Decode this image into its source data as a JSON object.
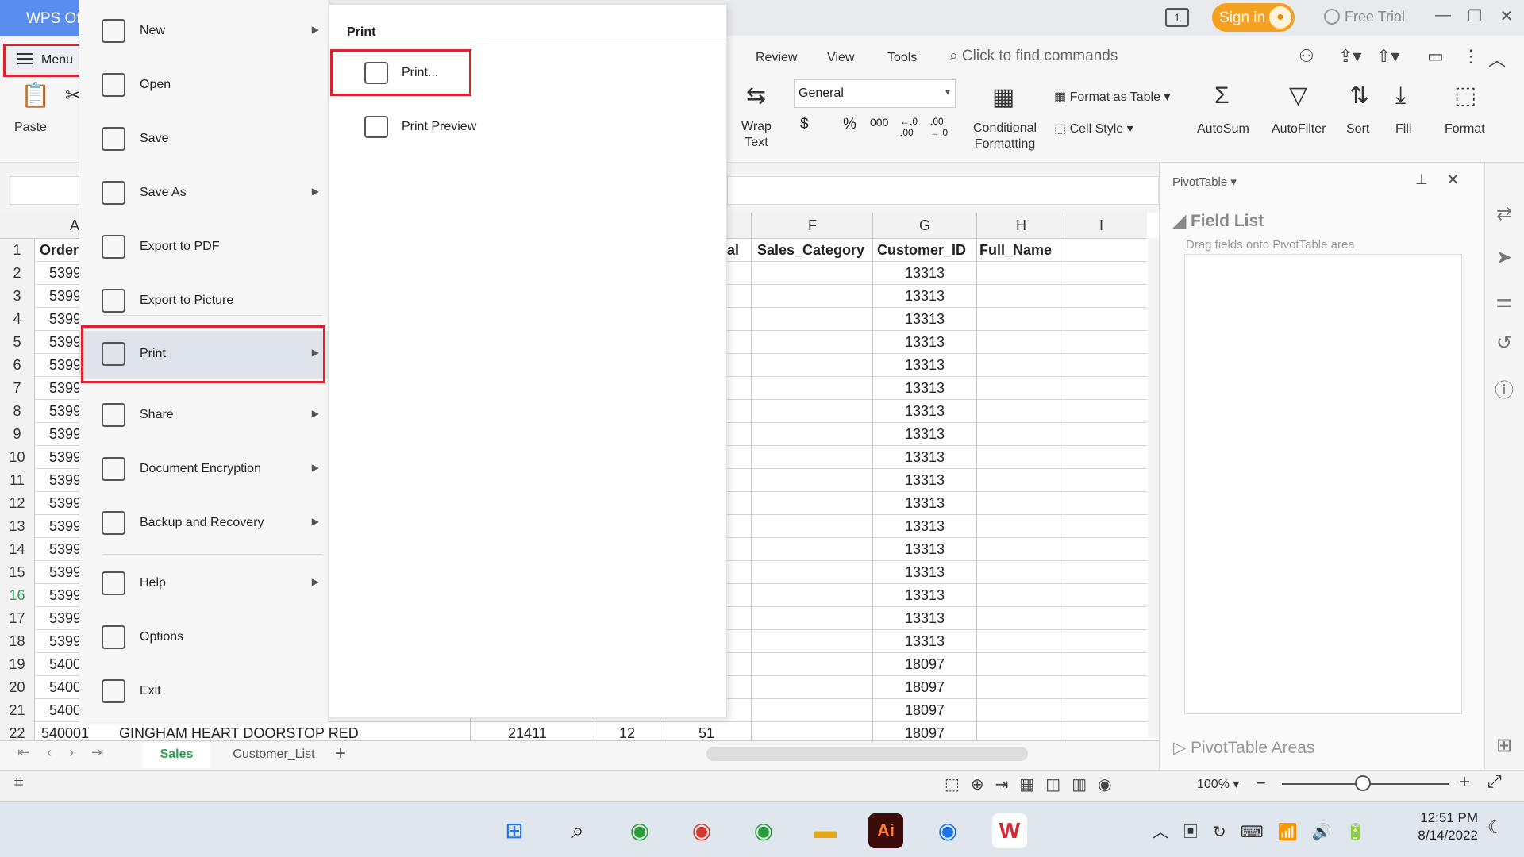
{
  "titlebar": {
    "app_tab": "WPS Office",
    "tab_count": "1",
    "signin": "Sign in",
    "free_trial": "Free Trial"
  },
  "ribbon": {
    "menu_label": "Menu",
    "tabs": [
      "Review",
      "View",
      "Tools"
    ],
    "search_placeholder": "Click to find commands",
    "paste_label": "Paste",
    "wrap_text": [
      "Wrap",
      "Text"
    ],
    "number_format": "General",
    "conditional_formatting": [
      "Conditional",
      "Formatting"
    ],
    "format_as_table": "Format as Table",
    "cell_style": "Cell Style",
    "autosum": "AutoSum",
    "autofilter": "AutoFilter",
    "sort": "Sort",
    "fill": "Fill",
    "format": "Format",
    "number_symbols": [
      "$",
      "%",
      "000",
      "←.0 .00",
      ".00 →.0"
    ]
  },
  "file_menu": {
    "items": [
      {
        "label": "New",
        "icon": "new-file-icon",
        "submenu": true
      },
      {
        "label": "Open",
        "icon": "folder-icon",
        "submenu": false
      },
      {
        "label": "Save",
        "icon": "save-icon",
        "submenu": false
      },
      {
        "label": "Save As",
        "icon": "save-as-icon",
        "submenu": true
      },
      {
        "label": "Export to PDF",
        "icon": "pdf-icon",
        "submenu": false
      },
      {
        "label": "Export to Picture",
        "icon": "picture-icon",
        "submenu": false
      },
      {
        "label": "Print",
        "icon": "printer-icon",
        "submenu": true
      },
      {
        "label": "Share",
        "icon": "share-icon",
        "submenu": true
      },
      {
        "label": "Document Encryption",
        "icon": "encryption-icon",
        "submenu": true
      },
      {
        "label": "Backup and Recovery",
        "icon": "backup-icon",
        "submenu": true
      },
      {
        "label": "Help",
        "icon": "help-icon",
        "submenu": true
      },
      {
        "label": "Options",
        "icon": "gear-icon",
        "submenu": false
      },
      {
        "label": "Exit",
        "icon": "exit-icon",
        "submenu": false
      }
    ],
    "selected": "Print"
  },
  "print_submenu": {
    "title": "Print",
    "items": [
      {
        "label": "Print...",
        "icon": "printer-icon"
      },
      {
        "label": "Print Preview",
        "icon": "print-preview-icon"
      }
    ]
  },
  "sheet": {
    "col_headers": [
      "A",
      "F",
      "G",
      "H",
      "I"
    ],
    "headers": {
      "A": "Order",
      "E": "tal",
      "F": "Sales_Category",
      "G": "Customer_ID",
      "H": "Full_Name"
    },
    "rows": [
      {
        "n": "2",
        "a": "5399",
        "g": "13313"
      },
      {
        "n": "3",
        "a": "5399",
        "g": "13313"
      },
      {
        "n": "4",
        "a": "5399",
        "g": "13313"
      },
      {
        "n": "5",
        "a": "5399",
        "g": "13313"
      },
      {
        "n": "6",
        "a": "5399",
        "g": "13313"
      },
      {
        "n": "7",
        "a": "5399",
        "g": "13313"
      },
      {
        "n": "8",
        "a": "5399",
        "g": "13313"
      },
      {
        "n": "9",
        "a": "5399",
        "g": "13313"
      },
      {
        "n": "10",
        "a": "5399",
        "g": "13313"
      },
      {
        "n": "11",
        "a": "5399",
        "g": "13313"
      },
      {
        "n": "12",
        "a": "5399",
        "g": "13313"
      },
      {
        "n": "13",
        "a": "5399",
        "g": "13313"
      },
      {
        "n": "14",
        "a": "5399",
        "g": "13313"
      },
      {
        "n": "15",
        "a": "5399",
        "g": "13313"
      },
      {
        "n": "16",
        "a": "5399",
        "g": "13313"
      },
      {
        "n": "17",
        "a": "5399",
        "g": "13313"
      },
      {
        "n": "18",
        "a": "5399",
        "g": "13313"
      },
      {
        "n": "19",
        "a": "5400",
        "g": "18097"
      },
      {
        "n": "20",
        "a": "5400",
        "g": "18097"
      },
      {
        "n": "21",
        "a": "5400",
        "g": "18097"
      }
    ],
    "last_row": {
      "n": "22",
      "a": "540001",
      "b": "GINGHAM HEART  DOORSTOP RED",
      "c": "21411",
      "d": "12",
      "e": "51",
      "g": "18097"
    },
    "header_row_number": "1",
    "tabs": [
      "Sales",
      "Customer_List"
    ],
    "active_tab": "Sales"
  },
  "pivot": {
    "title": "PivotTable",
    "field_list": "Field List",
    "drag_hint": "Drag fields onto PivotTable area",
    "areas": "PivotTable Areas"
  },
  "status": {
    "zoom": "100%"
  },
  "taskbar": {
    "time": "12:51 PM",
    "date": "8/14/2022"
  },
  "colors": {
    "accent": "#5b8def",
    "highlight": "#d9232f",
    "signin": "#f4a020"
  }
}
